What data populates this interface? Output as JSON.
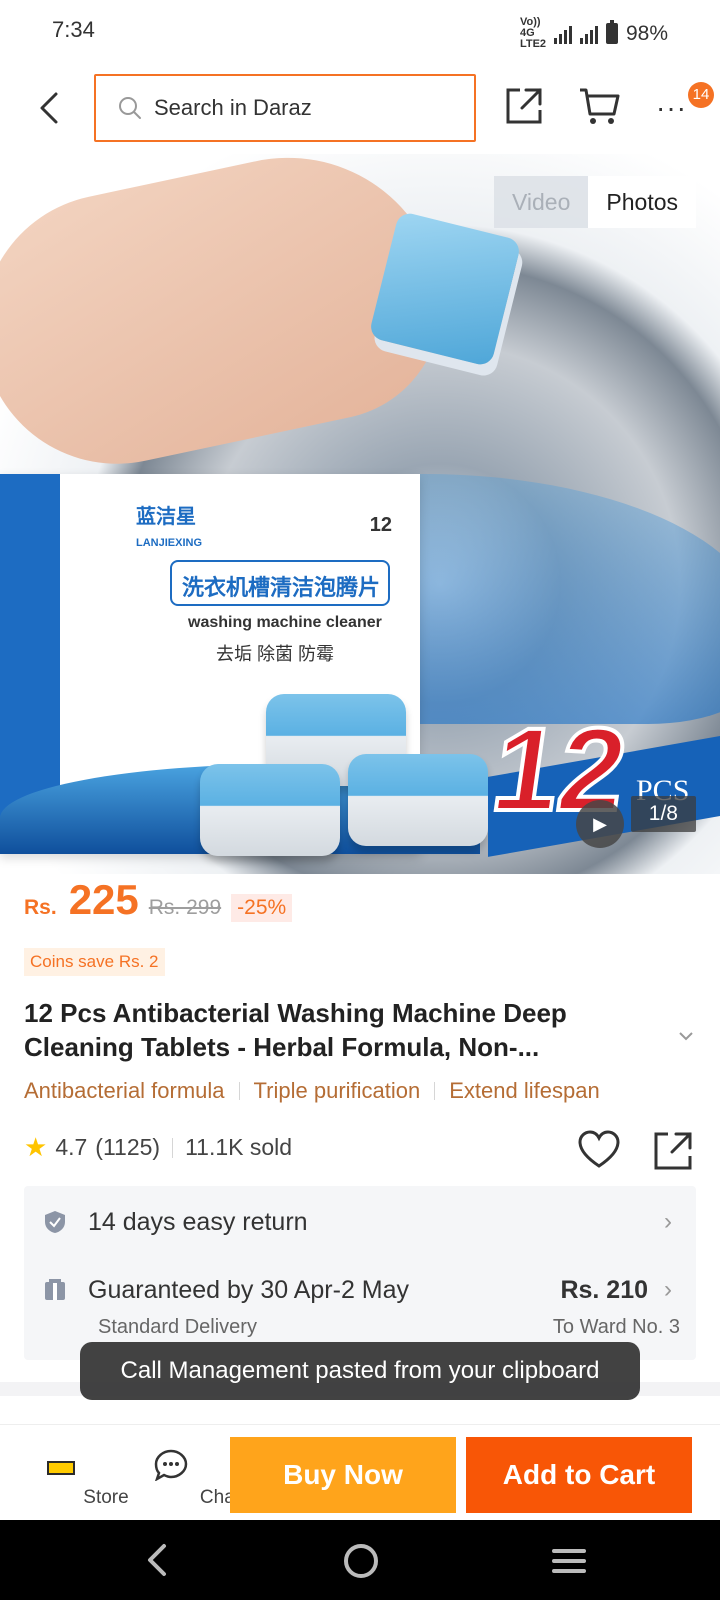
{
  "status_bar": {
    "time": "7:34",
    "network_top": "Vo)) 4G",
    "network_sub": "LTE2",
    "battery": "98%"
  },
  "header": {
    "search_placeholder": "Search in Daraz",
    "cart_badge": "14"
  },
  "gallery": {
    "video_label": "Video",
    "photos_label": "Photos",
    "page_indicator": "1/8",
    "product_text": {
      "brand": "蓝洁星",
      "brand_sub": "LANJIEXING",
      "count": "12",
      "headline": "洗衣机槽清洁泡腾片",
      "cleaner": "washing machine cleaner",
      "benefits": "去垢  除菌  防霉",
      "big_number": "12",
      "pcs": "PCS"
    }
  },
  "price": {
    "currency": "Rs.",
    "value": "225",
    "old": "Rs. 299",
    "discount": "-25%"
  },
  "coins": "Coins save Rs. 2",
  "title": "12 Pcs Antibacterial Washing Machine Deep Cleaning Tablets - Herbal Formula, Non-...",
  "features": [
    "Antibacterial formula",
    "Triple purification",
    "Extend lifespan"
  ],
  "rating": {
    "score": "4.7",
    "count": "(1125)",
    "sold": "11.1K sold"
  },
  "services": {
    "return": "14 days easy return",
    "delivery": "Guaranteed by 30 Apr-2 May",
    "delivery_price": "Rs. 210",
    "delivery_type": "Standard Delivery",
    "delivery_to": "To Ward No. 3"
  },
  "toast": "Call Management pasted from your clipboard",
  "bottom_bar": {
    "store": "Store",
    "chat": "Chat",
    "buy_now": "Buy Now",
    "add_to_cart": "Add to Cart"
  },
  "colors": {
    "accent": "#f57224",
    "buy_now": "#ffa41b",
    "add_to_cart": "#f85606",
    "feature_text": "#b56d35"
  }
}
